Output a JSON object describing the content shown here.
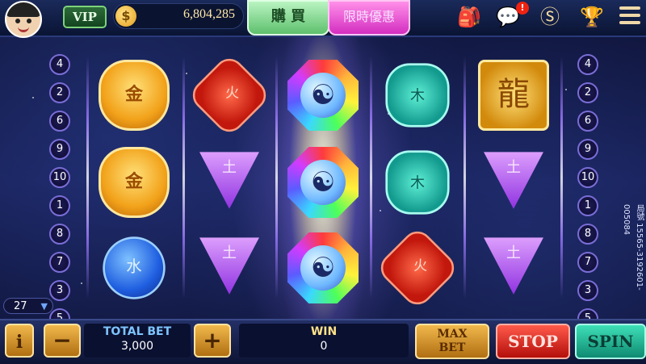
{
  "header": {
    "vip_label": "VIP",
    "coin_balance": "6,804,285",
    "buy_label": "購 買",
    "promo_label": "限時優惠",
    "notification_badge": "!"
  },
  "paylines": {
    "left": [
      "4",
      "2",
      "6",
      "9",
      "10",
      "1",
      "8",
      "7",
      "3",
      "5"
    ],
    "right": [
      "4",
      "2",
      "6",
      "9",
      "10",
      "1",
      "8",
      "7",
      "3",
      "5"
    ]
  },
  "reels": [
    [
      "gold-lock-metal",
      "gold-lock-metal",
      "blue-coin-water"
    ],
    [
      "red-fire-gem",
      "purple-triangle-earth",
      "purple-triangle-earth"
    ],
    [
      "rainbow-yinyang",
      "rainbow-yinyang",
      "rainbow-yinyang"
    ],
    [
      "teal-lotus-wood",
      "teal-lotus-wood",
      "red-fire-gem"
    ],
    [
      "gold-dragon",
      "purple-triangle-earth",
      "purple-triangle-earth"
    ]
  ],
  "symbol_glyphs": {
    "metal": "金",
    "fire": "火",
    "earth": "土",
    "wood": "木",
    "water": "水",
    "yinyang": "☯",
    "dragon": "龍"
  },
  "lines_selector": "27",
  "round_id": "局號 15565-3192601-005084",
  "bottom": {
    "info_label": "i",
    "minus_label": "−",
    "plus_label": "+",
    "total_bet_label": "TOTAL BET",
    "total_bet_value": "3,000",
    "win_label": "WIN",
    "win_value": "0",
    "max_bet_label_1": "MAX",
    "max_bet_label_2": "BET",
    "stop_label": "STOP",
    "spin_label": "SPIN"
  },
  "colors": {
    "reel_light": "#fff6c8",
    "accent_gold": "#f1b84c",
    "stop_red": "#d8211a",
    "spin_teal": "#1fb898"
  }
}
